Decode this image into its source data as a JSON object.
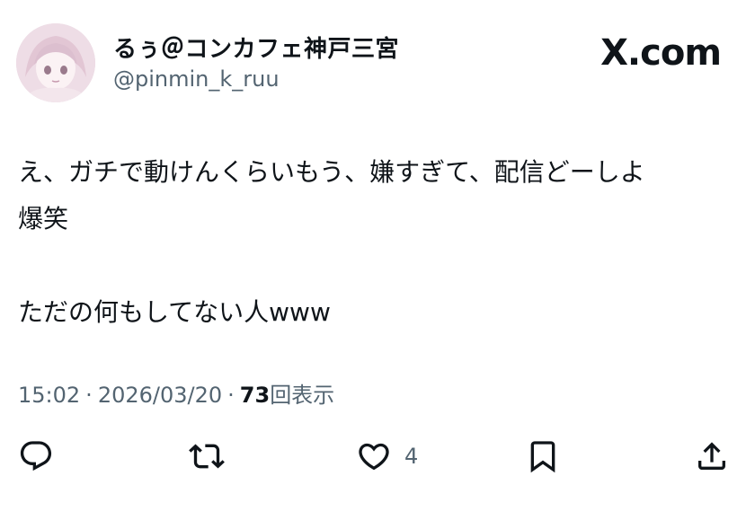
{
  "author": {
    "display_name": "るぅ＠コンカフェ神戸三宮",
    "handle": "@pinmin_k_ruu",
    "avatar_icon": "avatar-illustration"
  },
  "brand": "X.com",
  "tweet": {
    "lines": [
      "え、ガチで動けんくらいもう、嫌すぎて、配信どーしよ",
      "爆笑",
      "",
      "ただの何もしてない人www"
    ]
  },
  "meta": {
    "time": "15:02",
    "date": "2026/03/20",
    "views_count": "73",
    "views_label": "回表示",
    "separator": "·"
  },
  "actions": {
    "reply_icon": "reply-icon",
    "repost_icon": "repost-icon",
    "like_icon": "heart-icon",
    "like_count": "4",
    "bookmark_icon": "bookmark-icon",
    "share_icon": "share-icon"
  },
  "colors": {
    "text": "#0f1419",
    "secondary": "#536471"
  }
}
